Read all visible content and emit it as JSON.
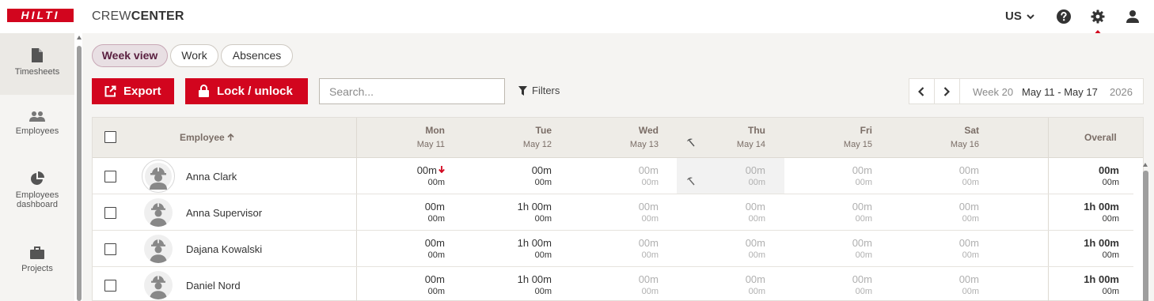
{
  "header": {
    "logo_text": "HILTI",
    "app_title_light": "CREW",
    "app_title_bold": "CENTER",
    "language": "US"
  },
  "sidebar": {
    "items": [
      {
        "label": "Timesheets",
        "icon": "document-icon",
        "active": true
      },
      {
        "label": "Employees",
        "icon": "people-icon",
        "active": false
      },
      {
        "label": "Employees dashboard",
        "icon": "pie-chart-icon",
        "active": false
      },
      {
        "label": "Projects",
        "icon": "briefcase-icon",
        "active": false
      }
    ]
  },
  "tabs": [
    {
      "label": "Week view",
      "active": true
    },
    {
      "label": "Work",
      "active": false
    },
    {
      "label": "Absences",
      "active": false
    }
  ],
  "toolbar": {
    "export_label": "Export",
    "lock_label": "Lock / unlock",
    "search_placeholder": "Search...",
    "filters_label": "Filters"
  },
  "week_nav": {
    "week_label": "Week 20",
    "range": "May 11 - May 17",
    "year": "2026"
  },
  "table": {
    "employee_header": "Employee",
    "overall_header": "Overall",
    "days": [
      {
        "name": "Mon",
        "date": "May 11"
      },
      {
        "name": "Tue",
        "date": "May 12"
      },
      {
        "name": "Wed",
        "date": "May 13"
      },
      {
        "name": "Thu",
        "date": "May 14"
      },
      {
        "name": "Fri",
        "date": "May 15"
      },
      {
        "name": "Sat",
        "date": "May 16"
      }
    ],
    "rows": [
      {
        "name": "Anna Clark",
        "cells": [
          [
            "00m",
            "00m"
          ],
          [
            "00m",
            "00m"
          ],
          [
            "00m",
            "00m"
          ],
          [
            "00m",
            "00m"
          ],
          [
            "00m",
            "00m"
          ],
          [
            "00m",
            "00m"
          ]
        ],
        "overall": [
          "00m",
          "00m"
        ]
      },
      {
        "name": "Anna Supervisor",
        "cells": [
          [
            "00m",
            "00m"
          ],
          [
            "1h 00m",
            "00m"
          ],
          [
            "00m",
            "00m"
          ],
          [
            "00m",
            "00m"
          ],
          [
            "00m",
            "00m"
          ],
          [
            "00m",
            "00m"
          ]
        ],
        "overall": [
          "1h 00m",
          "00m"
        ]
      },
      {
        "name": "Dajana Kowalski",
        "cells": [
          [
            "00m",
            "00m"
          ],
          [
            "1h 00m",
            "00m"
          ],
          [
            "00m",
            "00m"
          ],
          [
            "00m",
            "00m"
          ],
          [
            "00m",
            "00m"
          ],
          [
            "00m",
            "00m"
          ]
        ],
        "overall": [
          "1h 00m",
          "00m"
        ]
      },
      {
        "name": "Daniel Nord",
        "cells": [
          [
            "00m",
            "00m"
          ],
          [
            "1h 00m",
            "00m"
          ],
          [
            "00m",
            "00m"
          ],
          [
            "00m",
            "00m"
          ],
          [
            "00m",
            "00m"
          ],
          [
            "00m",
            "00m"
          ]
        ],
        "overall": [
          "1h 00m",
          "00m"
        ]
      }
    ]
  },
  "colors": {
    "brand_red": "#d2051e",
    "active_tab_bg": "#e8dfe3",
    "header_bg": "#eeece7"
  }
}
